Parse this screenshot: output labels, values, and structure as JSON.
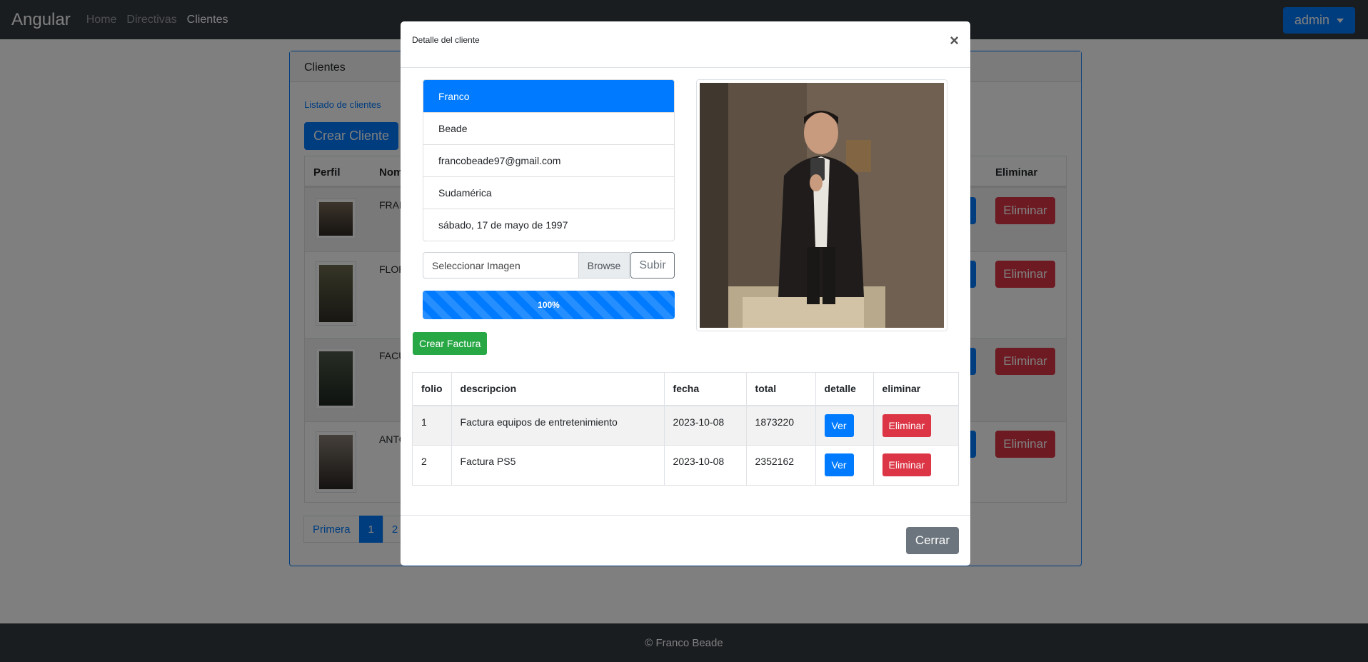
{
  "navbar": {
    "brand": "Angular",
    "links": [
      "Home",
      "Directivas",
      "Clientes"
    ],
    "user_menu": "admin"
  },
  "card": {
    "header": "Clientes",
    "subtitle": "Listado de clientes",
    "create_button": "Crear Cliente",
    "columns": {
      "perfil": "Perfil",
      "nombre": "Nom",
      "eliminar": "Eliminar"
    },
    "rows": [
      {
        "name": "FRAN",
        "delete": "Eliminar"
      },
      {
        "name": "FLOR",
        "delete": "Eliminar"
      },
      {
        "name": "FACU",
        "delete": "Eliminar"
      },
      {
        "name": "ANTO",
        "delete": "Eliminar"
      }
    ],
    "pagination": [
      "Primera",
      "1",
      "2"
    ],
    "pagination_active": "1"
  },
  "footer": {
    "text": "© Franco Beade"
  },
  "modal": {
    "title": "Detalle del cliente",
    "close_symbol": "×",
    "client": {
      "nombre": "Franco",
      "apellido": "Beade",
      "email": "francobeade97@gmail.com",
      "region": "Sudamérica",
      "fecha": "sábado, 17 de mayo de 1997"
    },
    "file_input": {
      "label": "Seleccionar Imagen",
      "browse": "Browse",
      "upload": "Subir"
    },
    "progress": {
      "value": 100,
      "label": "100%"
    },
    "create_invoice": "Crear Factura",
    "invoices": {
      "headers": [
        "folio",
        "descripcion",
        "fecha",
        "total",
        "detalle",
        "eliminar"
      ],
      "rows": [
        {
          "folio": "1",
          "descripcion": "Factura equipos de entretenimiento",
          "fecha": "2023-10-08",
          "total": "1873220",
          "ver": "Ver",
          "eliminar": "Eliminar"
        },
        {
          "folio": "2",
          "descripcion": "Factura PS5",
          "fecha": "2023-10-08",
          "total": "2352162",
          "ver": "Ver",
          "eliminar": "Eliminar"
        }
      ]
    },
    "close_button": "Cerrar"
  },
  "colors": {
    "primary": "#007bff",
    "danger": "#dc3545",
    "success": "#28a745",
    "secondary": "#6c757d",
    "dark": "#343a40"
  }
}
